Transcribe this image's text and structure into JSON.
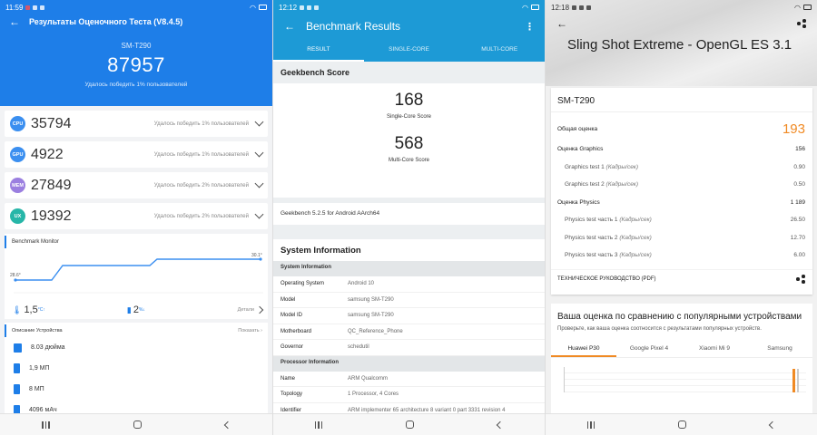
{
  "antutu": {
    "status_time": "11:59",
    "title": "Результаты Оценочного Теста (V8.4.5)",
    "device": "SM-T290",
    "total": "87957",
    "beat_text": "Удалось победить 1% пользователей",
    "scores": [
      {
        "badge": "CPU",
        "value": "35794",
        "beat": "Удалось победить 1% пользователей",
        "color": "#3b8ff0"
      },
      {
        "badge": "GPU",
        "value": "4922",
        "beat": "Удалось победить 1% пользователей",
        "color": "#3b8ff0"
      },
      {
        "badge": "MEM",
        "value": "27849",
        "beat": "Удалось победить 2% пользователей",
        "color": "#9b7fe0"
      },
      {
        "badge": "UX",
        "value": "19392",
        "beat": "Удалось победить 2% пользователей",
        "color": "#27b6a8"
      }
    ],
    "monitor": {
      "title": "Benchmark Monitor",
      "start_temp": "28.6°",
      "end_temp": "30.1°",
      "temp_delta": "1,5",
      "temp_unit": "°C↑",
      "battery_delta": "2",
      "battery_unit": "%↓",
      "details": "Детали",
      "line_color": "#3b8ff0"
    },
    "device_desc": {
      "title": "Описание Устройства",
      "show": "Показать",
      "items": [
        "8.03 дюйма",
        "1,9 МП",
        "8 МП",
        "4096 мАч"
      ]
    }
  },
  "geekbench": {
    "status_time": "12:12",
    "title": "Benchmark Results",
    "tabs": [
      "RESULT",
      "SINGLE-CORE",
      "MULTI-CORE"
    ],
    "score_section": "Geekbench Score",
    "single_score": "168",
    "single_label": "Single-Core Score",
    "multi_score": "568",
    "multi_label": "Multi-Core Score",
    "version": "Geekbench 5.2.5 for Android AArch64",
    "sys_title": "System Information",
    "groups": [
      {
        "name": "System Information",
        "rows": [
          {
            "k": "Operating System",
            "v": "Android 10"
          },
          {
            "k": "Model",
            "v": "samsung SM-T290"
          },
          {
            "k": "Model ID",
            "v": "samsung SM-T290"
          },
          {
            "k": "Motherboard",
            "v": "QC_Reference_Phone"
          },
          {
            "k": "Governor",
            "v": "schedutil"
          }
        ]
      },
      {
        "name": "Processor Information",
        "rows": [
          {
            "k": "Name",
            "v": "ARM Qualcomm"
          },
          {
            "k": "Topology",
            "v": "1 Processor, 4 Cores"
          },
          {
            "k": "Identifier",
            "v": "ARM implementer 65 architecture 8 variant 0 part 3331 revision 4"
          }
        ]
      }
    ]
  },
  "threedmark": {
    "status_time": "12:18",
    "title": "Sling Shot Extreme - OpenGL ES 3.1",
    "device": "SM-T290",
    "overall_label": "Общая оценка",
    "overall_value": "193",
    "rows": [
      {
        "label": "Оценка Graphics",
        "unit": "",
        "value": "156",
        "sub": false
      },
      {
        "label": "Graphics test 1 ",
        "unit": "(Кадры/сек)",
        "value": "0.90",
        "sub": true
      },
      {
        "label": "Graphics test 2 ",
        "unit": "(Кадры/сек)",
        "value": "0.50",
        "sub": true
      },
      {
        "label": "Оценка Physics",
        "unit": "",
        "value": "1 189",
        "sub": false
      },
      {
        "label": "Physics test часть 1 ",
        "unit": "(Кадры/сек)",
        "value": "26.50",
        "sub": true
      },
      {
        "label": "Physics test часть 2 ",
        "unit": "(Кадры/сек)",
        "value": "12.70",
        "sub": true
      },
      {
        "label": "Physics test часть 3 ",
        "unit": "(Кадры/сек)",
        "value": "6.00",
        "sub": true
      }
    ],
    "guide": "ТЕХНИЧЕСКОЕ РУКОВОДСТВО (PDF)",
    "compare_title": "Ваша оценка по сравнению с популярными устройствами",
    "compare_desc": "Проверьте, как ваша оценка соотносится с результатами популярных устройств.",
    "compare_tabs": [
      "Huawei P30",
      "Google Pixel 4",
      "Xiaomi Mi 9",
      "Samsung"
    ],
    "accent": "#f08a24"
  }
}
